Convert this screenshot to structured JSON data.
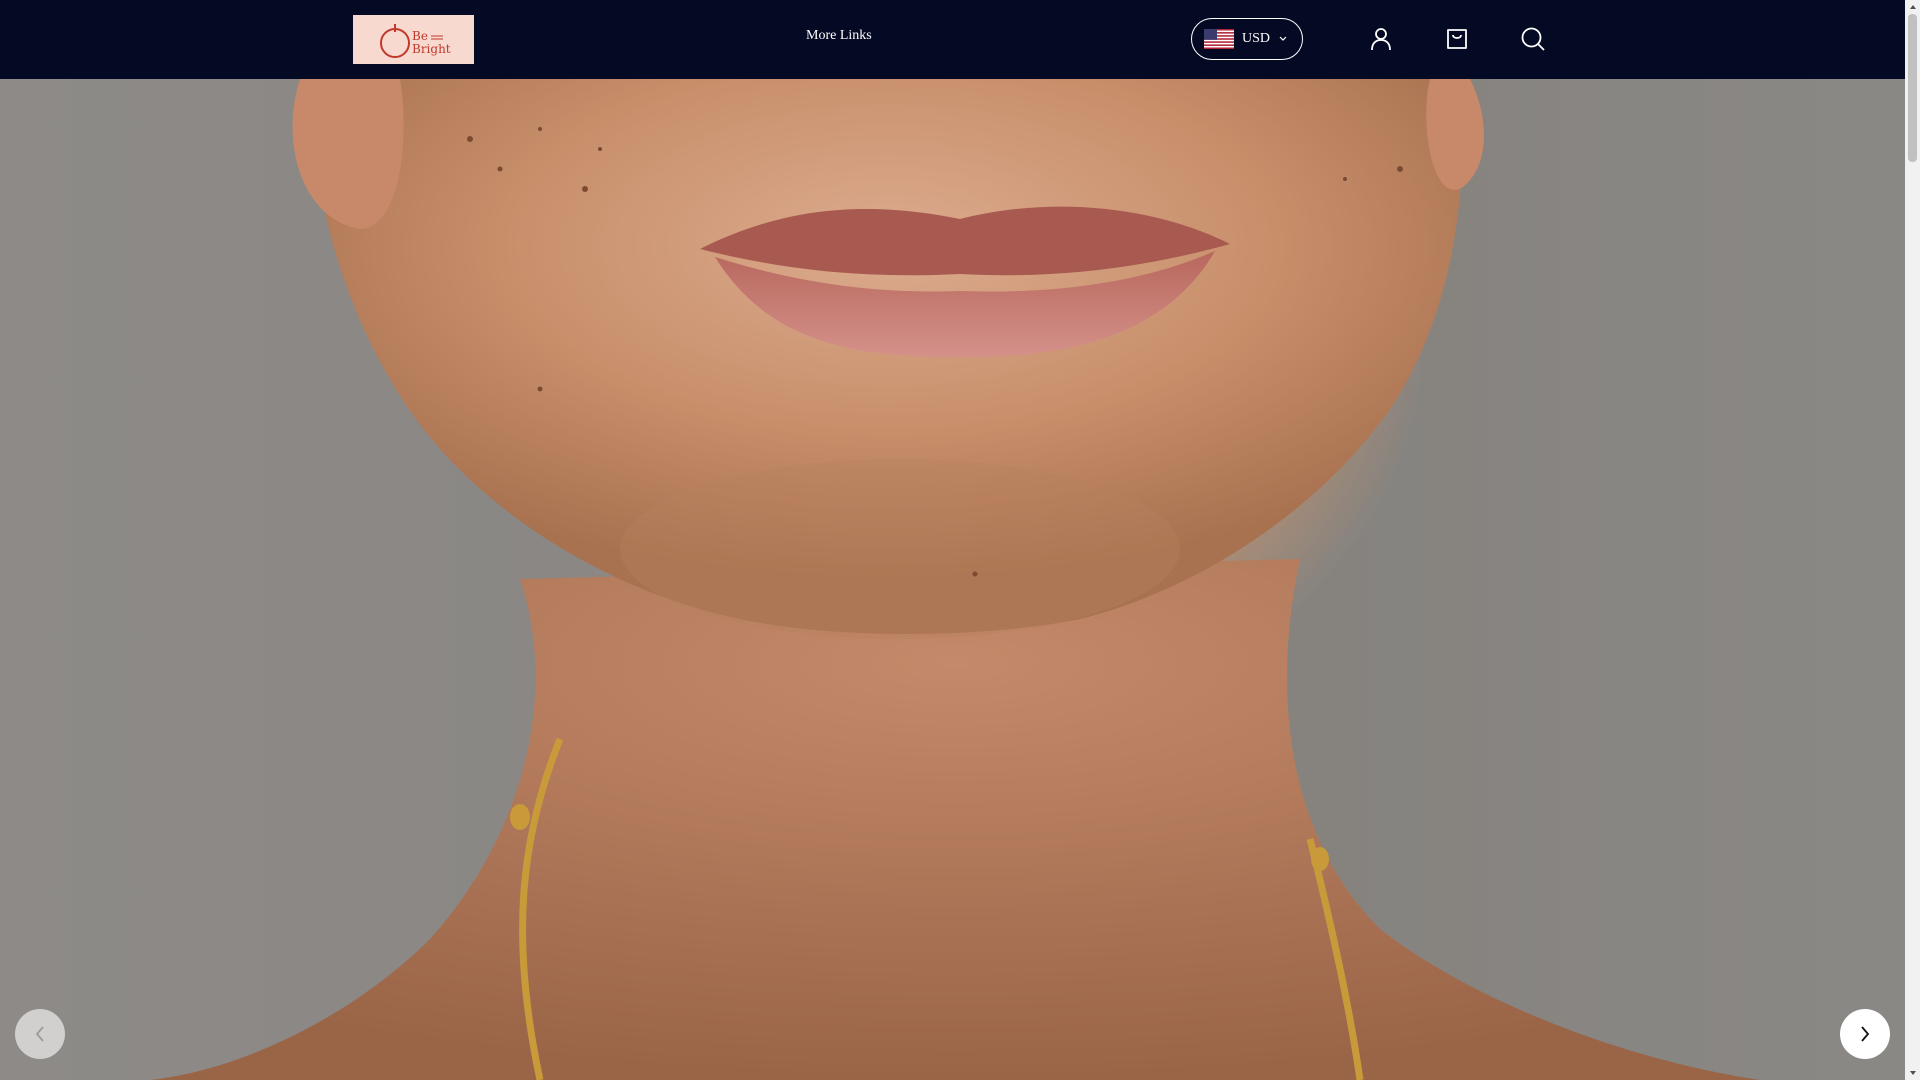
{
  "header": {
    "logo_text_line1": "Be",
    "logo_text_line2": "Bright",
    "nav_link": "More Links",
    "currency": "USD",
    "icons": {
      "flag": "us-flag-icon",
      "currency_chevron": "chevron-down-icon",
      "account": "user-icon",
      "cart": "shopping-bag-icon",
      "search": "search-icon"
    }
  },
  "hero": {
    "image": "woman-smile-closeup"
  },
  "slider": {
    "prev_icon": "chevron-left-icon",
    "next_icon": "chevron-right-icon"
  },
  "colors": {
    "header_bg": "#050a24",
    "logo_bg": "#f8d9cf",
    "logo_accent": "#c0392b"
  }
}
